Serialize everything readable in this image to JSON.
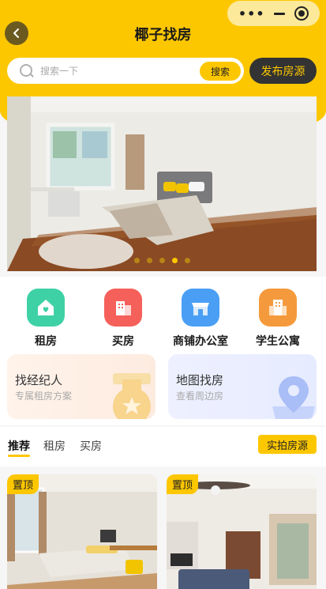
{
  "header": {
    "title": "椰子找房",
    "capsule_more": "•••"
  },
  "search": {
    "placeholder": "搜索一下",
    "button": "搜索",
    "publish": "发布房源"
  },
  "banner": {
    "slide_count": 5,
    "active_index": 3
  },
  "categories": [
    {
      "label": "租房",
      "icon": "house-heart-icon",
      "color": "#3fd1a6"
    },
    {
      "label": "买房",
      "icon": "building-icon",
      "color": "#f5605a"
    },
    {
      "label": "商铺办公室",
      "icon": "storefront-icon",
      "color": "#4a9ff5"
    },
    {
      "label": "学生公寓",
      "icon": "apartment-icon",
      "color": "#f59a3c"
    }
  ],
  "cards": [
    {
      "title": "找经纪人",
      "subtitle": "专属租房方案",
      "icon": "medal-icon"
    },
    {
      "title": "地图找房",
      "subtitle": "查看周边房",
      "icon": "map-pin-icon"
    }
  ],
  "tabs": {
    "items": [
      "推荐",
      "租房",
      "买房"
    ],
    "active": 0,
    "action": "实拍房源"
  },
  "listings": [
    {
      "badge": "置顶"
    },
    {
      "badge": "置顶"
    }
  ]
}
